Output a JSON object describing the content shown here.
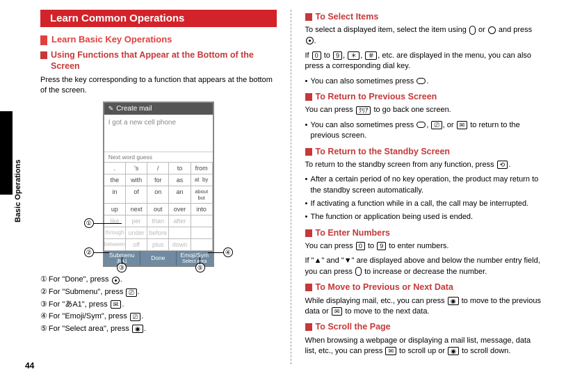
{
  "page_number": "44",
  "side_label": "Basic Operations",
  "left": {
    "h1": "Learn Common Operations",
    "h2": "Learn Basic Key Operations",
    "sec1": {
      "title": "Using Functions that Appear at the Bottom of the Screen",
      "body": "Press the key corresponding to a function that appears at the bottom of the screen."
    },
    "phone": {
      "title": "Create mail",
      "input": "I got a new cell phone",
      "hint": "Next word guess",
      "rows": [
        [
          ".",
          "'s",
          "/",
          "to",
          "from"
        ],
        [
          "the",
          "with",
          "for",
          "as",
          "at  by"
        ],
        [
          "in",
          "of",
          "on",
          "an",
          "about but"
        ],
        [
          "up",
          "next",
          "out",
          "over",
          "into"
        ],
        [
          "like",
          "per",
          "than",
          "after",
          ""
        ],
        [
          "through",
          "under",
          "before",
          "",
          ""
        ],
        [
          "between",
          "off",
          "plus",
          "down",
          ""
        ]
      ],
      "soft_left_top": "Submenu",
      "soft_left_sub": "あA1",
      "soft_mid": "Done",
      "soft_right_top": "Emoji/Sym",
      "soft_right_sub": "Select area"
    },
    "legend": {
      "l1": "For \"Done\", press",
      "l2": "For \"Submenu\", press",
      "l3": "For \"あA1\", press",
      "l4": "For \"Emoji/Sym\", press",
      "l5": "For \"Select area\", press"
    }
  },
  "right": {
    "select": {
      "title": "To Select Items",
      "p1a": "To select a displayed item, select the item using ",
      "p1b": " or ",
      "p1c": " and press ",
      "p1d": ".",
      "p2a": "If ",
      "p2b": " to ",
      "p2c": ", ",
      "p2d": ", ",
      "p2e": ", etc. are displayed in the menu, you can also press a corresponding dial key.",
      "b1": "You can also sometimes press ",
      "k0": "0",
      "k9": "9",
      "kStar": "＊",
      "kHash": "＃"
    },
    "prev": {
      "title": "To Return to Previous Screen",
      "p1a": "You can press ",
      "p1b": " to go back one screen.",
      "b1a": "You can also sometimes press ",
      "b1b": ", ",
      "b1c": ", or ",
      "b1d": " to return to the previous screen.",
      "kclr": "ｸﾘｱ"
    },
    "standby": {
      "title": "To Return to the Standby Screen",
      "p1a": "To return to the standby screen from any function, press ",
      "p1b": ".",
      "b1": "After a certain period of no key operation, the product may return to the standby screen automatically.",
      "b2": "If activating a function while in a call, the call may be interrupted.",
      "b3": "The function or application being used is ended."
    },
    "numbers": {
      "title": "To Enter Numbers",
      "p1a": "You can press ",
      "p1b": " to ",
      "p1c": " to enter numbers.",
      "p2a": "If \"▲\" and \"▼\" are displayed above and below the number entry field, you can press ",
      "p2b": " to increase or decrease the number.",
      "k0": "0",
      "k9": "9"
    },
    "move": {
      "title": "To Move to Previous or Next Data",
      "p1a": "While displaying mail, etc., you can press ",
      "p1b": " to move to the previous data or ",
      "p1c": " to move to the next data."
    },
    "scroll": {
      "title": "To Scroll the Page",
      "p1a": "When browsing a webpage or displaying a mail list, message, data list, etc., you can press ",
      "p1b": " to scroll up or ",
      "p1c": " to scroll down."
    }
  }
}
